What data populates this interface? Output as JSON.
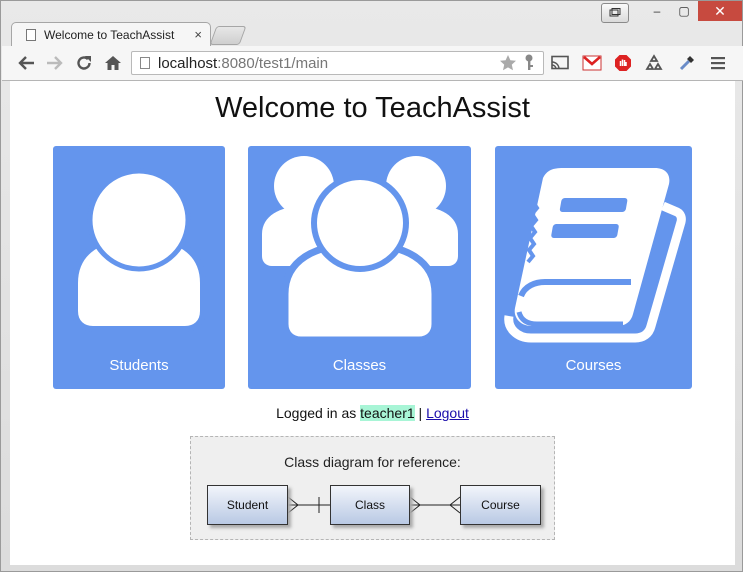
{
  "browser": {
    "tab_title": "Welcome to TeachAssist",
    "tab_close": "×",
    "url_host": "localhost",
    "url_rest": ":8080/test1/main",
    "window_min": "–",
    "window_max": "▢",
    "window_close": "✕"
  },
  "page": {
    "heading": "Welcome to TeachAssist",
    "cards": [
      {
        "label": "Students",
        "icon": "student-icon"
      },
      {
        "label": "Classes",
        "icon": "classes-icon"
      },
      {
        "label": "Courses",
        "icon": "book-icon"
      }
    ],
    "login": {
      "prefix": "Logged in as ",
      "username": "teacher1",
      "separator": " | ",
      "logout_label": "Logout"
    },
    "diagram": {
      "title": "Class diagram for reference:",
      "classes": [
        "Student",
        "Class",
        "Course"
      ]
    }
  },
  "colors": {
    "card": "#6495ed",
    "highlight": "#a8f5d6",
    "link": "#1a0dab",
    "close_button": "#c74a3f"
  }
}
